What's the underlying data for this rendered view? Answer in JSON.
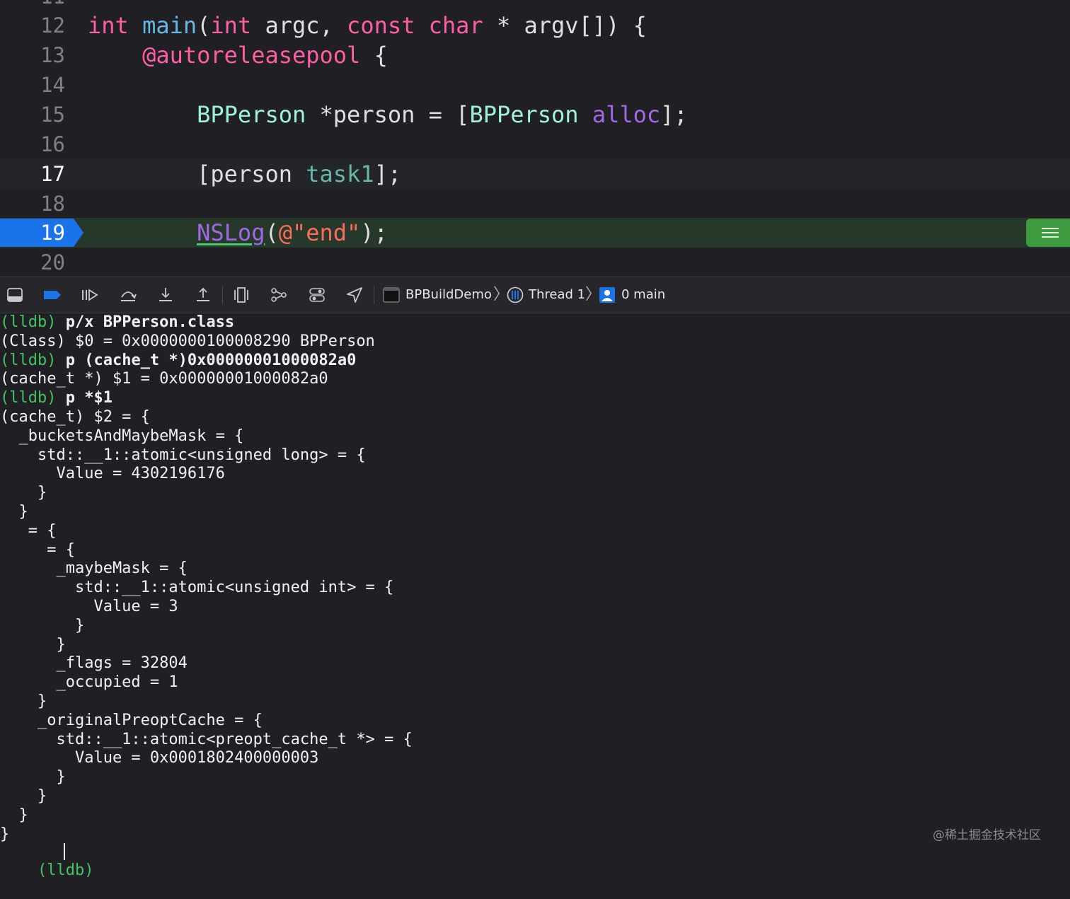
{
  "editor": {
    "partial_line_above": "11",
    "lines": [
      {
        "num": "12",
        "code": "int main(int argc, const char * argv[]) {"
      },
      {
        "num": "13",
        "code": "    @autoreleasepool {"
      },
      {
        "num": "14",
        "code": ""
      },
      {
        "num": "15",
        "code": "        BPPerson *person = [BPPerson alloc];"
      },
      {
        "num": "16",
        "code": ""
      },
      {
        "num": "17",
        "code": "        [person task1];"
      },
      {
        "num": "18",
        "code": ""
      },
      {
        "num": "19",
        "code": "        NSLog(@\"end\");"
      },
      {
        "num": "20",
        "code": ""
      }
    ],
    "current_line": "17",
    "pc_line": "19"
  },
  "debugbar": {
    "buttons": [
      "hide-debug-area-icon",
      "breakpoints-toggle-icon",
      "continue-icon",
      "step-over-icon",
      "step-into-icon",
      "step-out-icon",
      "view-hierarchy-icon",
      "memory-graph-icon",
      "environment-overrides-icon",
      "simulate-location-icon"
    ],
    "breadcrumb": {
      "target": "BPBuildDemo",
      "thread": "Thread 1",
      "frame": "0 main"
    },
    "accent_color": "#1a73e8"
  },
  "console": {
    "prompt": "(lldb)",
    "lines": [
      {
        "prompt": "(lldb)",
        "text": " p/x BPPerson.class",
        "bold": true
      },
      {
        "prompt": "",
        "text": "(Class) $0 = 0x0000000100008290 BPPerson",
        "bold": false
      },
      {
        "prompt": "(lldb)",
        "text": " p (cache_t *)0x00000001000082a0",
        "bold": true
      },
      {
        "prompt": "",
        "text": "(cache_t *) $1 = 0x00000001000082a0",
        "bold": false
      },
      {
        "prompt": "(lldb)",
        "text": " p *$1",
        "bold": true
      },
      {
        "prompt": "",
        "text": "(cache_t) $2 = {",
        "bold": false
      },
      {
        "prompt": "",
        "text": "  _bucketsAndMaybeMask = {",
        "bold": false
      },
      {
        "prompt": "",
        "text": "    std::__1::atomic<unsigned long> = {",
        "bold": false
      },
      {
        "prompt": "",
        "text": "      Value = 4302196176",
        "bold": false
      },
      {
        "prompt": "",
        "text": "    }",
        "bold": false
      },
      {
        "prompt": "",
        "text": "  }",
        "bold": false
      },
      {
        "prompt": "",
        "text": "   = {",
        "bold": false
      },
      {
        "prompt": "",
        "text": "     = {",
        "bold": false
      },
      {
        "prompt": "",
        "text": "      _maybeMask = {",
        "bold": false
      },
      {
        "prompt": "",
        "text": "        std::__1::atomic<unsigned int> = {",
        "bold": false
      },
      {
        "prompt": "",
        "text": "          Value = 3",
        "bold": false
      },
      {
        "prompt": "",
        "text": "        }",
        "bold": false
      },
      {
        "prompt": "",
        "text": "      }",
        "bold": false
      },
      {
        "prompt": "",
        "text": "      _flags = 32804",
        "bold": false
      },
      {
        "prompt": "",
        "text": "      _occupied = 1",
        "bold": false
      },
      {
        "prompt": "",
        "text": "    }",
        "bold": false
      },
      {
        "prompt": "",
        "text": "    _originalPreoptCache = {",
        "bold": false
      },
      {
        "prompt": "",
        "text": "      std::__1::atomic<preopt_cache_t *> = {",
        "bold": false
      },
      {
        "prompt": "",
        "text": "        Value = 0x0001802400000003",
        "bold": false
      },
      {
        "prompt": "",
        "text": "      }",
        "bold": false
      },
      {
        "prompt": "",
        "text": "    }",
        "bold": false
      },
      {
        "prompt": "",
        "text": "  }",
        "bold": false
      },
      {
        "prompt": "",
        "text": "}",
        "bold": false
      }
    ],
    "input_prompt": "(lldb)"
  },
  "watermark": "@稀土掘金技术社区"
}
